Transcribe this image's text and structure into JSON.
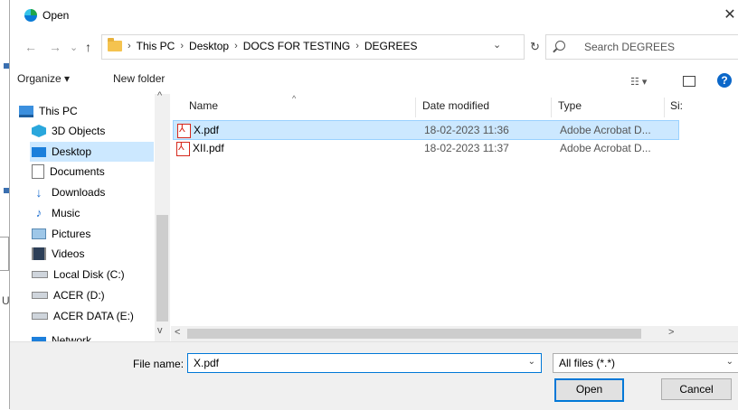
{
  "window": {
    "title": "Open",
    "close_glyph": "✕"
  },
  "nav": {
    "back": "←",
    "forward": "→",
    "recent": "⌄",
    "up": "↑"
  },
  "address": {
    "crumbs": [
      "This PC",
      "Desktop",
      "DOCS FOR TESTING",
      "DEGREES"
    ],
    "separator": "›",
    "dropdown": "⌄",
    "refresh": "↻"
  },
  "search": {
    "placeholder": "Search DEGREES"
  },
  "toolbar": {
    "organize": "Organize ▾",
    "new_folder": "New folder",
    "view_glyph": "☷ ▾",
    "help": "?"
  },
  "sidebar": {
    "items": [
      {
        "label": "This PC",
        "icon": "computer-icon"
      },
      {
        "label": "3D Objects",
        "icon": "cube-icon"
      },
      {
        "label": "Desktop",
        "icon": "desktop-icon"
      },
      {
        "label": "Documents",
        "icon": "document-icon"
      },
      {
        "label": "Downloads",
        "icon": "download-icon"
      },
      {
        "label": "Music",
        "icon": "music-icon"
      },
      {
        "label": "Pictures",
        "icon": "pictures-icon"
      },
      {
        "label": "Videos",
        "icon": "video-icon"
      },
      {
        "label": "Local Disk (C:)",
        "icon": "disk-icon"
      },
      {
        "label": "ACER (D:)",
        "icon": "drive-icon"
      },
      {
        "label": "ACER DATA (E:)",
        "icon": "drive-icon"
      },
      {
        "label": "Network",
        "icon": "network-icon"
      }
    ]
  },
  "columns": {
    "name": "Name",
    "date": "Date modified",
    "type": "Type",
    "size": "Si:",
    "sort_glyph": "^"
  },
  "files": [
    {
      "name": "X.pdf",
      "date": "18-02-2023 11:36",
      "type": "Adobe Acrobat D..."
    },
    {
      "name": "XII.pdf",
      "date": "18-02-2023 11:37",
      "type": "Adobe Acrobat D..."
    }
  ],
  "scroll": {
    "up": "^",
    "down": "v",
    "left": "<",
    "right": ">"
  },
  "footer": {
    "file_name_label": "File name:",
    "file_name_value": "X.pdf",
    "file_name_drop": "⌄",
    "file_type": "All files (*.*)",
    "file_type_drop": "⌄",
    "open_label": "Open",
    "cancel_label": "Cancel"
  },
  "background": {
    "letter": "U"
  }
}
